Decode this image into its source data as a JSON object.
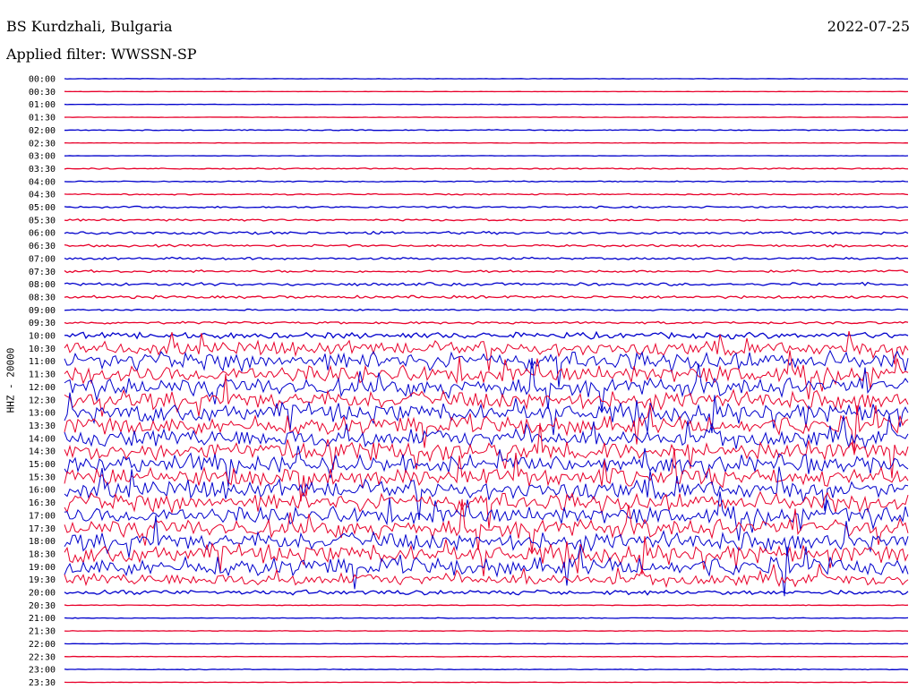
{
  "header": {
    "station": "BS Kurdzhali, Bulgaria",
    "date": "2022-07-25",
    "filter": "Applied filter: WWSSN-SP"
  },
  "chart_data": {
    "type": "line",
    "title": "BS Kurdzhali, Bulgaria",
    "subtitle": "Applied filter: WWSSN-SP",
    "ylabel": "HHZ - 20000",
    "xlabel": "",
    "rows": [
      "00:00",
      "00:30",
      "01:00",
      "01:30",
      "02:00",
      "02:30",
      "03:00",
      "03:30",
      "04:00",
      "04:30",
      "05:00",
      "05:30",
      "06:00",
      "06:30",
      "07:00",
      "07:30",
      "08:00",
      "08:30",
      "09:00",
      "09:30",
      "10:00",
      "10:30",
      "11:00",
      "11:30",
      "12:00",
      "12:30",
      "13:00",
      "13:30",
      "14:00",
      "14:30",
      "15:00",
      "15:30",
      "16:00",
      "16:30",
      "17:00",
      "17:30",
      "18:00",
      "18:30",
      "19:00",
      "19:30",
      "20:00",
      "20:30",
      "21:00",
      "21:30",
      "22:00",
      "22:30",
      "23:00",
      "23:30"
    ],
    "amplitude": [
      0.3,
      0.2,
      0.3,
      0.3,
      0.6,
      0.3,
      0.3,
      0.8,
      0.7,
      0.8,
      1.2,
      1.3,
      1.8,
      1.5,
      1.5,
      1.6,
      2.0,
      1.8,
      1.0,
      1.5,
      4,
      9,
      12,
      12,
      12,
      12,
      12,
      12,
      12,
      12,
      12,
      12,
      12,
      12,
      12,
      12,
      12,
      12,
      12,
      8,
      3,
      0.5,
      0.5,
      0.4,
      0.3,
      0.3,
      0.5,
      0.3
    ],
    "colors": [
      "#0000cc",
      "#e8002a"
    ],
    "grid": false,
    "legend": "none"
  }
}
